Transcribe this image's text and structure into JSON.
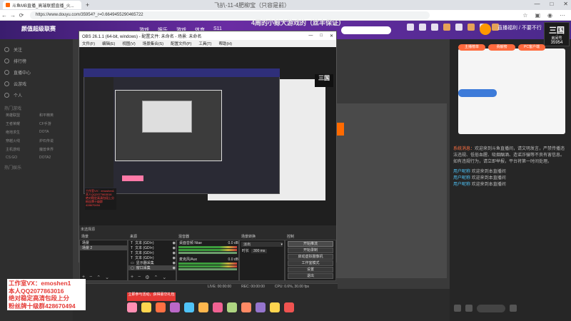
{
  "browser": {
    "tab_title": "斗鱼MB直播_高端联盟直播_火...",
    "window_title": "飞扒-11-4肥柳宝（只容是前）",
    "new_tab": "+",
    "url": "https://www.douyu.com/35954?_r=0.6649455290465722",
    "window_controls": [
      "—",
      "□",
      "✕"
    ],
    "nav": [
      "←",
      "→",
      "⟳"
    ]
  },
  "douyu": {
    "logo_text": "颜值超级联赛",
    "nav_items": [
      "游戏",
      "娱乐",
      "游戏",
      "体育",
      "S11"
    ],
    "stream_title": "4周的小鲸大游戏的（丝丰保证）",
    "promo_text": "直播福利 / 不要不行",
    "room_badge_big": "三国",
    "room_badge_small": "房间号",
    "room_number": "35954"
  },
  "sidebar": {
    "items": [
      "关注",
      "排行榜",
      "直播中心",
      "云游戏",
      "个人"
    ],
    "section_head": "热门游戏",
    "categories": [
      "英雄联盟",
      "和平精英",
      "王者荣耀",
      "CF手游",
      "绝地求生",
      "DOTA",
      "穿越火线",
      "炉石传说",
      "主机游戏",
      "魔兽世界",
      "CS:GO",
      "DOTA2"
    ],
    "section_head2": "热门娱乐"
  },
  "obs": {
    "title": "OBS 26.1.1 (64-bit, windows) - 配置文件: 未命名 - 场景: 未命名",
    "menu": [
      "文件(F)",
      "编辑(E)",
      "视图(V)",
      "场景集合(S)",
      "配置文件(P)",
      "工具(T)",
      "帮助(H)"
    ],
    "preview_logo": "三国",
    "preview_red_lines": [
      "工作室VX：emoshen1",
      "本人QQ2077863016",
      "绝对稳定高清包段上分",
      "粉丝牌十级群428670494"
    ],
    "dock_headers": [
      "场景",
      "来源",
      "混音器",
      "场景转换",
      "控制"
    ],
    "dock_tab": "未选择源",
    "scenes": [
      "场景",
      "场景 2"
    ],
    "sources": [
      "文本 (GDI+)",
      "文本 (GDI+)",
      "文本 (GDI+)",
      "文本 (GDI+)",
      "显示器采集",
      "窗口采集"
    ],
    "mixer": [
      {
        "name": "桌面音频 Ntae",
        "level": "0.0 dB"
      },
      {
        "name": "麦克风/Aux",
        "level": "0.0 dB"
      }
    ],
    "transition": {
      "type": "淡出",
      "duration_label": "时长",
      "duration": "300 ms"
    },
    "controls": [
      "开始推流",
      "开始录制",
      "启动虚拟摄像机",
      "工作室模式",
      "设置",
      "退出"
    ],
    "status": {
      "live": "LIVE: 00:00:00",
      "rec": "REC: 00:00:00",
      "cpu": "CPU: 0.6%, 30.00 fps"
    }
  },
  "chat": {
    "system_label": "系统消息：",
    "system_msg": "欢迎来到斗鱼直播间，请文明发言，严禁传播违法违规、低俗血腥、吸烟酗酒、造谣诈骗等不良有害信息。如有违规行为，请立即举报，平台将第一时间处理。",
    "lines": [
      {
        "name": "用户昵称",
        "text": "欢迎来到本直播间"
      },
      {
        "name": "用户昵称",
        "text": "欢迎来到本直播间"
      },
      {
        "name": "用户昵称",
        "text": "欢迎来到本直播间"
      }
    ]
  },
  "right_panel": {
    "pill1": "主播榜单",
    "pill2": "贡献榜",
    "pill3": "PC客户端"
  },
  "watermark": [
    "工作室VX：emoshen1",
    "本人QQ2077863016",
    "绝对稳定高清包段上分",
    "粉丝牌十级群428670494"
  ],
  "gifts": {
    "promo": "立即参与活动，获得豪华礼包"
  }
}
